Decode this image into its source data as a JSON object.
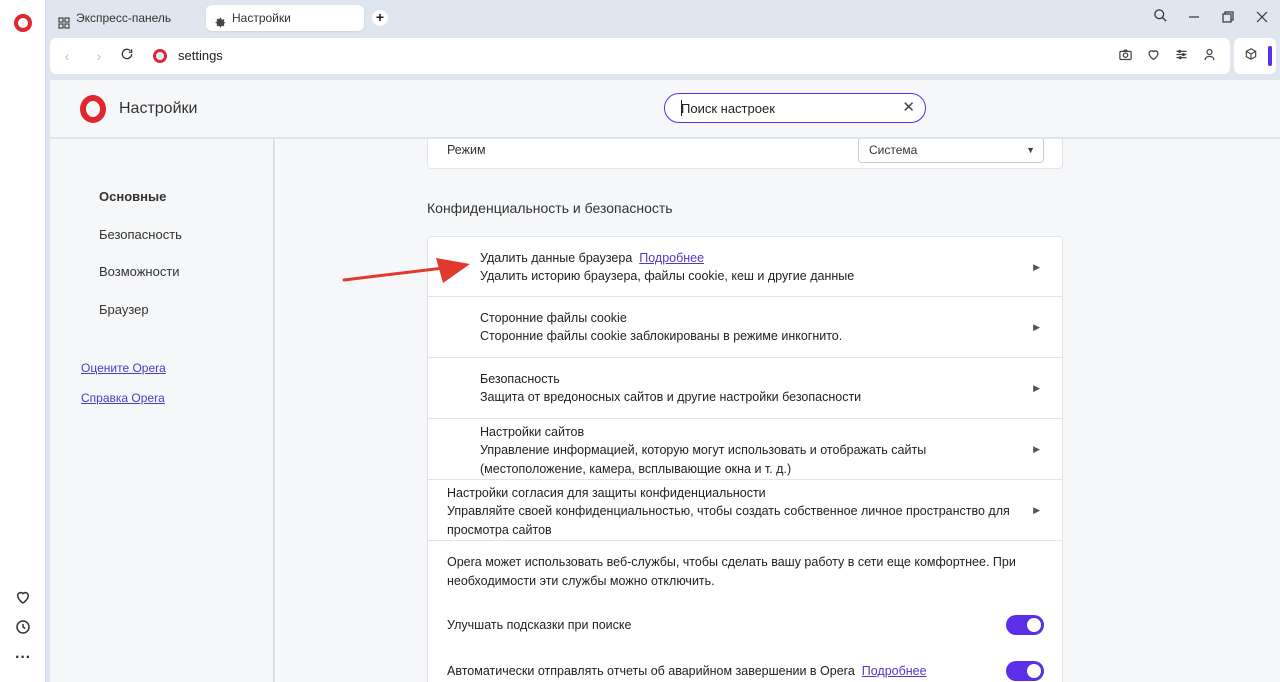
{
  "tabs": [
    {
      "label": "Экспресс-панель",
      "icon": "grid-icon"
    },
    {
      "label": "Настройки",
      "icon": "gear-icon"
    }
  ],
  "address": {
    "url": "settings"
  },
  "header": {
    "title": "Настройки",
    "search_value": "Поиск настроек"
  },
  "menu": {
    "items": [
      "Основные",
      "Безопасность",
      "Возможности",
      "Браузер"
    ],
    "links": [
      "Оцените Opera",
      "Справка Opera"
    ]
  },
  "appearance": {
    "mode_label": "Режим",
    "mode_value": "Система"
  },
  "privacy": {
    "section_title": "Конфиденциальность и безопасность",
    "clear_data": {
      "title": "Удалить данные браузера",
      "link": "Подробнее",
      "subtitle": "Удалить историю браузера, файлы cookie, кеш и другие данные"
    },
    "cookies": {
      "title": "Сторонние файлы cookie",
      "subtitle": "Сторонние файлы cookie заблокированы в режиме инкогнито."
    },
    "security": {
      "title": "Безопасность",
      "subtitle": "Защита от вредоносных сайтов и другие настройки безопасности"
    },
    "site_settings": {
      "title": "Настройки сайтов",
      "subtitle_1": "Управление информацией, которую могут использовать и отображать сайты",
      "subtitle_2": "(местоположение, камера, всплывающие окна и т. д.)"
    },
    "consent": {
      "title": "Настройки согласия для защиты конфиденциальности",
      "subtitle_1": "Управляйте своей конфиденциальностью, чтобы создать собственное личное пространство для",
      "subtitle_2": "просмотра сайтов"
    },
    "web_services": {
      "text_1": "Opera может использовать веб-службы, чтобы сделать вашу работу в сети еще комфортнее. При",
      "text_2": "необходимости эти службы можно отключить."
    },
    "search_hints": {
      "label": "Улучшать подсказки при поиске",
      "enabled": true
    },
    "crash_reports": {
      "label": "Автоматически отправлять отчеты об аварийном завершении в Opera",
      "link": "Подробнее",
      "enabled": true
    }
  },
  "colors": {
    "accent": "#5b2ee8",
    "opera_red": "#e0262f",
    "annotation_arrow": "#e0392d"
  }
}
